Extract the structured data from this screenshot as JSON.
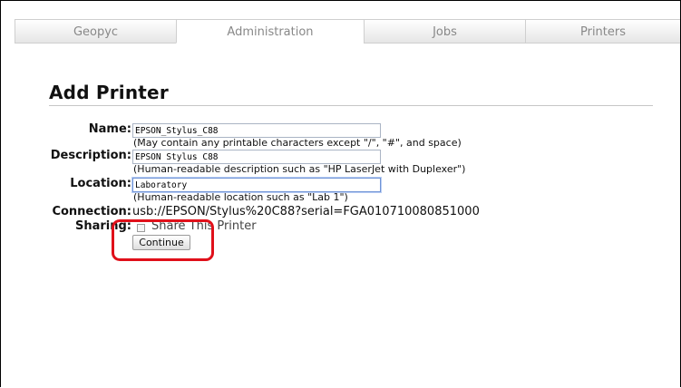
{
  "tabs": [
    {
      "label": "Geopyc"
    },
    {
      "label": "Administration"
    },
    {
      "label": "Jobs"
    },
    {
      "label": "Printers"
    }
  ],
  "active_tab": "Administration",
  "page": {
    "title": "Add Printer"
  },
  "form": {
    "name": {
      "label": "Name:",
      "value": "EPSON_Stylus_C88",
      "hint": "(May contain any printable characters except \"/\", \"#\", and space)"
    },
    "description": {
      "label": "Description:",
      "value": "EPSON Stylus C88",
      "hint": "(Human-readable description such as \"HP LaserJet with Duplexer\")"
    },
    "location": {
      "label": "Location:",
      "value": "Laboratory",
      "hint": "(Human-readable location such as \"Lab 1\")"
    },
    "connection": {
      "label": "Connection:",
      "value": "usb://EPSON/Stylus%20C88?serial=FGA010710080851000"
    },
    "sharing": {
      "label": "Sharing:",
      "checkbox_label": "Share This Printer",
      "checked": false
    },
    "continue_label": "Continue"
  },
  "annotation": {
    "color": "#e0101a",
    "target": "Continue"
  }
}
